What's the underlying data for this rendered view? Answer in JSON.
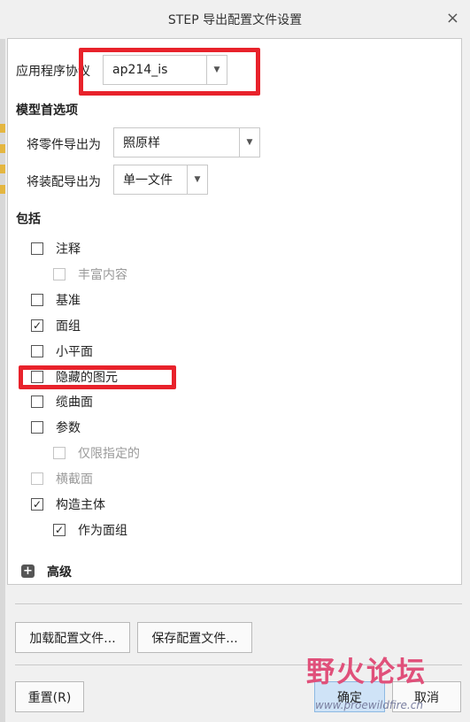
{
  "window": {
    "title": "STEP 导出配置文件设置",
    "close_glyph": "×"
  },
  "protocol": {
    "label": "应用程序协议",
    "value": "ap214_is"
  },
  "model_options": {
    "heading": "模型首选项",
    "part_export": {
      "label": "将零件导出为",
      "value": "照原样"
    },
    "assembly_export": {
      "label": "将装配导出为",
      "value": "单一文件"
    }
  },
  "include": {
    "heading": "包括",
    "items": [
      {
        "label": "注释",
        "checked": false,
        "disabled": false,
        "indent": 0
      },
      {
        "label": "丰富内容",
        "checked": false,
        "disabled": true,
        "indent": 1
      },
      {
        "label": "基准",
        "checked": false,
        "disabled": false,
        "indent": 0
      },
      {
        "label": "面组",
        "checked": true,
        "disabled": false,
        "indent": 0
      },
      {
        "label": "小平面",
        "checked": false,
        "disabled": false,
        "indent": 0
      },
      {
        "label": "隐藏的图元",
        "checked": false,
        "disabled": false,
        "indent": 0
      },
      {
        "label": "缆曲面",
        "checked": false,
        "disabled": false,
        "indent": 0
      },
      {
        "label": "参数",
        "checked": false,
        "disabled": false,
        "indent": 0
      },
      {
        "label": "仅限指定的",
        "checked": false,
        "disabled": true,
        "indent": 1
      },
      {
        "label": "横截面",
        "checked": false,
        "disabled": true,
        "indent": 0
      },
      {
        "label": "构造主体",
        "checked": true,
        "disabled": false,
        "indent": 0
      },
      {
        "label": "作为面组",
        "checked": true,
        "disabled": false,
        "indent": 1
      }
    ]
  },
  "advanced": {
    "label": "高级"
  },
  "buttons": {
    "load": "加载配置文件...",
    "save": "保存配置文件...",
    "reset": "重置(R)",
    "ok": "确定",
    "cancel": "取消"
  },
  "watermark": {
    "main": "野火论坛",
    "sub": "www.proewildfire.cn"
  },
  "colors": {
    "highlight": "#e8222b",
    "primary_button": "#cfe3f7"
  }
}
